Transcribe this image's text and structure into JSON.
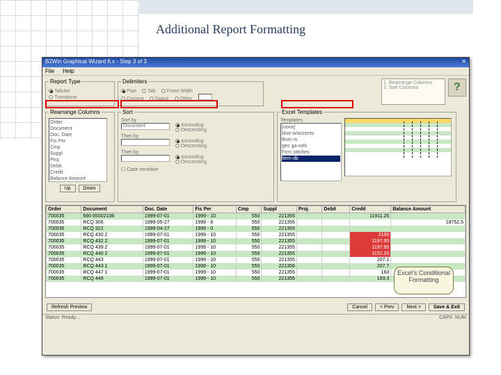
{
  "slide_title": "Additional Report Formatting",
  "window_title": "B2Win Graphical Wizard 6.x - Step 3 of 3",
  "menus": {
    "file": "File",
    "help": "Help"
  },
  "groups": {
    "report_type": "Report Type",
    "delimiters": "Delimiters",
    "rearrange": "Rearrange Columns",
    "sort": "Sort",
    "excel": "Excel Templates"
  },
  "report_type_options": [
    "Tabular",
    "Transpose"
  ],
  "delimiter_options": [
    "Pipe",
    "Tab",
    "Fixed Width",
    "Comma",
    "Space",
    "Other"
  ],
  "instructions": {
    "l1": "1. Rearrange Columns",
    "l2": "2. Sort Columns"
  },
  "help_glyph": "?",
  "field_list": [
    "Order",
    "Document",
    "Doc. Date",
    "Fis Per",
    "Cmp",
    "Suppl",
    "Proj.",
    "Debit",
    "Credit",
    "Balance Amount"
  ],
  "rearrange_buttons": {
    "up": "Up",
    "down": "Down"
  },
  "sort": {
    "sortby": "Sort by",
    "thenby": "Then by",
    "sel1": "Document",
    "asc": "Ascending",
    "desc": "Descending",
    "case": "Case sensitive"
  },
  "excel": {
    "templates_label": "Templates",
    "items": [
      "[none]",
      "blue w/accents",
      "Born-Is",
      "geo ga-cels",
      "Firm stitches",
      "Item-db"
    ],
    "selected": 5
  },
  "buttons": {
    "refresh": "Refresh Preview",
    "cancel": "Cancel",
    "prev": "< Prev",
    "next": "Next >",
    "save": "Save & Exit"
  },
  "status": {
    "left": "Status: Ready...",
    "caps": "CAPS",
    "num": "NUM"
  },
  "callout": "Excel's Conditional Formatting",
  "columns": [
    "Order",
    "Document",
    "Doc. Date",
    "Fis Per",
    "Cmp",
    "Suppl",
    "Proj.",
    "Debit",
    "Credit",
    "Balance Amount"
  ],
  "rows": [
    {
      "cls": "even",
      "c": [
        "700035",
        "690 65002108",
        "1999-07-01",
        "1999 - 10",
        "550",
        "221355",
        "",
        "",
        "11911.25",
        ""
      ]
    },
    {
      "cls": "odd",
      "c": [
        "700035",
        "RCQ   306",
        "1999-05-27",
        "1999 - 8",
        "550",
        "221355",
        "",
        "",
        "",
        "19752.5"
      ]
    },
    {
      "cls": "even",
      "c": [
        "700035",
        "RCQ   322",
        "1999-04-27",
        "1999 - 0",
        "550",
        "221355",
        "",
        "",
        "",
        ""
      ]
    },
    {
      "cls": "odd",
      "c": [
        "700035",
        "RCQ   430  2",
        "1999-07-01",
        "1999 - 10",
        "550",
        "221355",
        "",
        "",
        "2150",
        ""
      ],
      "red": [
        8
      ]
    },
    {
      "cls": "even",
      "c": [
        "700035",
        "RCQ   432  2",
        "1999-07-01",
        "1999 - 10",
        "550",
        "221355",
        "",
        "",
        "1197.95",
        ""
      ],
      "red": [
        8
      ]
    },
    {
      "cls": "odd",
      "c": [
        "700035",
        "RCQ   439  2",
        "1999-07-01",
        "1999 - 10",
        "550",
        "221355",
        "",
        "",
        "1197.95",
        ""
      ],
      "red": [
        8
      ]
    },
    {
      "cls": "even",
      "c": [
        "700035",
        "RCQ   440  2",
        "1999-07-01",
        "1999 - 10",
        "550",
        "221355",
        "",
        "",
        "1152.20",
        ""
      ],
      "red": [
        8
      ]
    },
    {
      "cls": "odd",
      "c": [
        "700035",
        "RCQ   443",
        "1999-07-01",
        "1999 - 10",
        "550",
        "221355",
        "",
        "",
        "207.1",
        ""
      ]
    },
    {
      "cls": "even",
      "c": [
        "700035",
        "RCQ   443  1",
        "1999-07-01",
        "1999 - 10",
        "550",
        "221356",
        "",
        "",
        "207.7",
        ""
      ]
    },
    {
      "cls": "odd",
      "c": [
        "700035",
        "RCQ   447  1",
        "1999-07-01",
        "1999 - 10",
        "550",
        "221355",
        "",
        "",
        "183",
        ""
      ]
    },
    {
      "cls": "even",
      "c": [
        "700035",
        "RCQ   449",
        "1999-07-01",
        "1999 - 10",
        "550",
        "221355",
        "",
        "",
        "183.3",
        ""
      ]
    }
  ],
  "chart_data": {
    "type": "table"
  }
}
